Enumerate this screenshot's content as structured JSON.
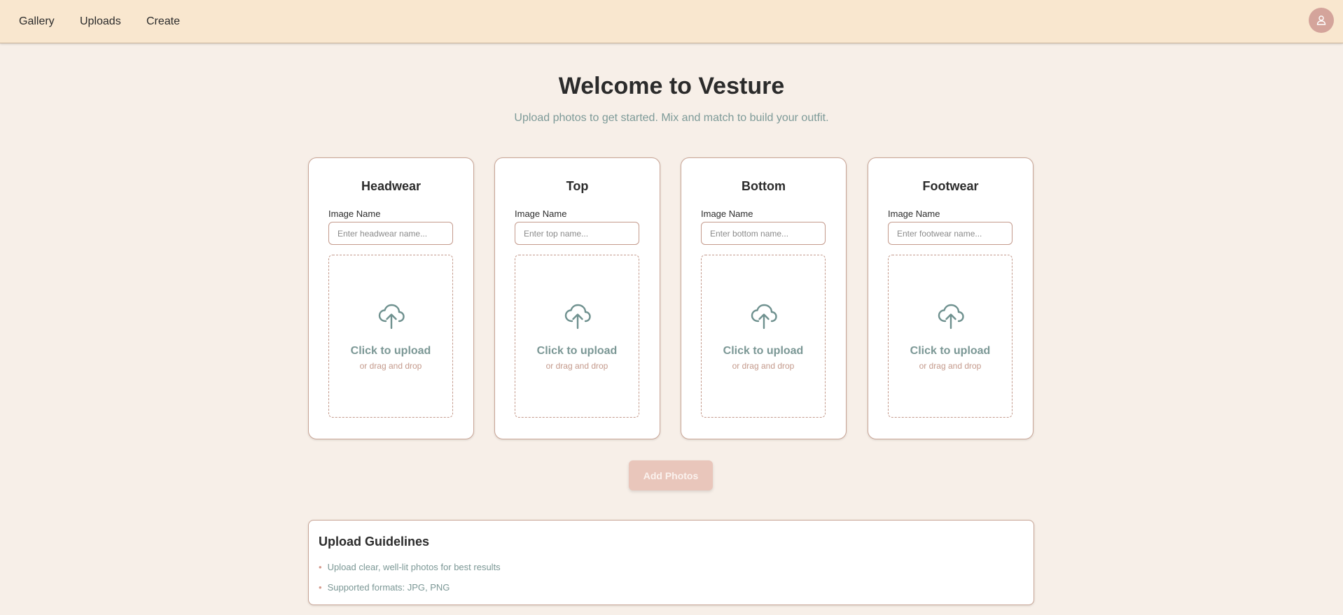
{
  "nav": {
    "items": [
      {
        "label": "Gallery"
      },
      {
        "label": "Uploads"
      },
      {
        "label": "Create"
      }
    ],
    "avatar_icon": "user-icon"
  },
  "hero": {
    "title": "Welcome to Vesture",
    "subtitle": "Upload photos to get started. Mix and match to build your outfit."
  },
  "cards": [
    {
      "title": "Headwear",
      "field_label": "Image Name",
      "placeholder": "Enter headwear name...",
      "value": "",
      "click_text": "Click to upload",
      "drag_text": "or drag and drop"
    },
    {
      "title": "Top",
      "field_label": "Image Name",
      "placeholder": "Enter top name...",
      "value": "",
      "click_text": "Click to upload",
      "drag_text": "or drag and drop"
    },
    {
      "title": "Bottom",
      "field_label": "Image Name",
      "placeholder": "Enter bottom name...",
      "value": "",
      "click_text": "Click to upload",
      "drag_text": "or drag and drop"
    },
    {
      "title": "Footwear",
      "field_label": "Image Name",
      "placeholder": "Enter footwear name...",
      "value": "",
      "click_text": "Click to upload",
      "drag_text": "or drag and drop"
    }
  ],
  "actions": {
    "add_photos_label": "Add Photos"
  },
  "guidelines": {
    "title": "Upload Guidelines",
    "items": [
      "Upload clear, well-lit photos for best results",
      "Supported formats: JPG, PNG"
    ]
  },
  "colors": {
    "header_bg": "#f9e7cf",
    "page_bg": "#f7efe8",
    "accent_teal": "#7b9795",
    "accent_rose": "#c49a8c",
    "button_disabled": "#e9c6bb"
  }
}
